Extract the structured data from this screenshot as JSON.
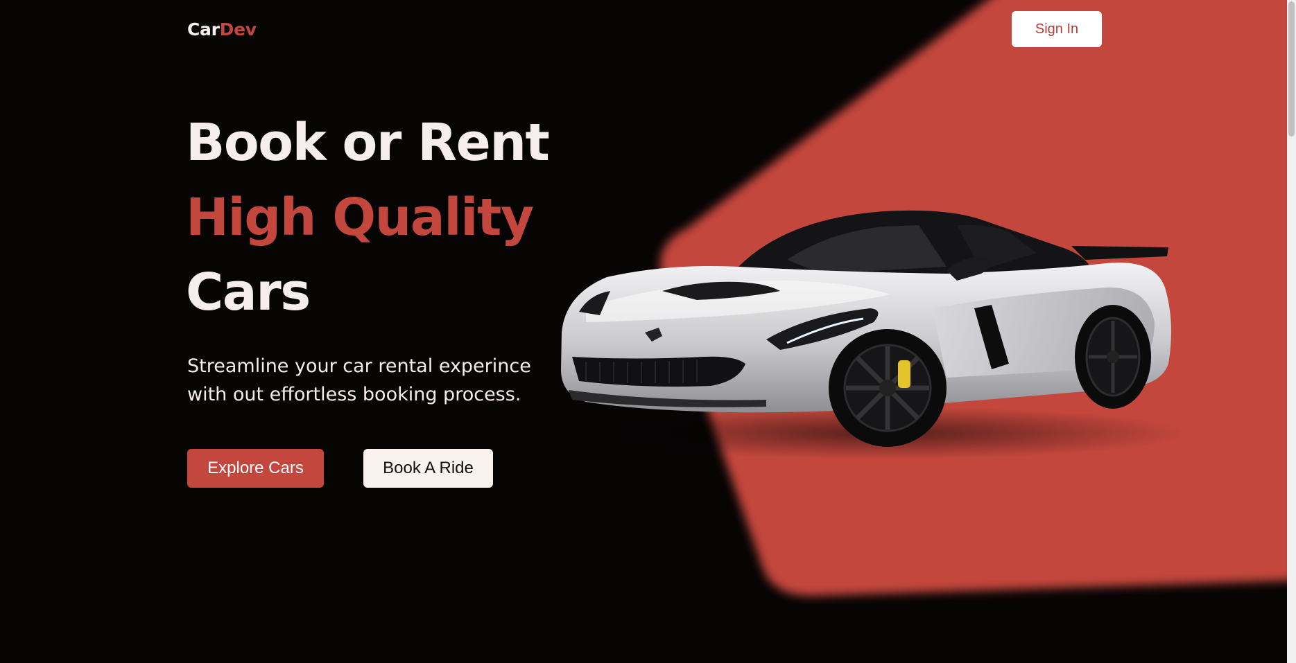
{
  "brand": {
    "logo_part1": "Car",
    "logo_part2": "Dev",
    "accent_color": "#c4473e",
    "background_color": "#070404"
  },
  "header": {
    "signin_label": "Sign In"
  },
  "hero": {
    "headline_line1": "Book or Rent",
    "headline_line2": "High Quality",
    "headline_line3": "Cars",
    "subtext_line1": "Streamline your car rental experince",
    "subtext_line2": "with out effortless booking process.",
    "primary_button": "Explore Cars",
    "secondary_button": "Book A Ride"
  },
  "icons": {
    "car_image": "sports-car-image"
  }
}
